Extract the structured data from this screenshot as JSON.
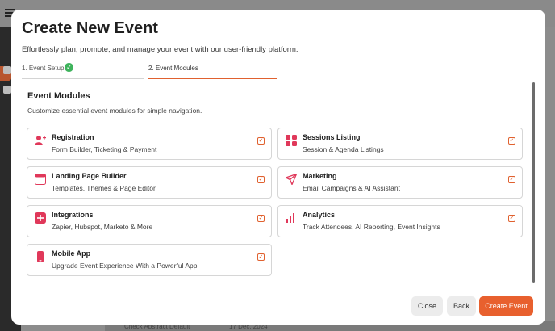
{
  "modal": {
    "title": "Create New Event",
    "subtitle": "Effortlessly plan, promote, and manage your event with our user-friendly platform."
  },
  "steps": [
    {
      "label": "1. Event Setup",
      "status": "completed"
    },
    {
      "label": "2. Event Modules",
      "status": "active"
    }
  ],
  "section": {
    "title": "Event Modules",
    "description": "Customize essential event modules for simple navigation."
  },
  "modules": [
    {
      "title": "Registration",
      "description": "Form Builder, Ticketing & Payment",
      "checked": true,
      "icon": "registration-icon"
    },
    {
      "title": "Sessions Listing",
      "description": "Session & Agenda Listings",
      "checked": true,
      "icon": "sessions-grid-icon"
    },
    {
      "title": "Landing Page Builder",
      "description": "Templates, Themes & Page Editor",
      "checked": true,
      "icon": "browser-window-icon"
    },
    {
      "title": "Marketing",
      "description": "Email Campaigns & AI Assistant",
      "checked": true,
      "icon": "paper-plane-icon"
    },
    {
      "title": "Integrations",
      "description": "Zapier, Hubspot, Marketo & More",
      "checked": true,
      "icon": "integrations-plus-icon"
    },
    {
      "title": "Analytics",
      "description": "Track Attendees, AI Reporting, Event Insights",
      "checked": true,
      "icon": "bar-chart-icon"
    },
    {
      "title": "Mobile App",
      "description": "Upgrade Event Experience With a Powerful App",
      "checked": true,
      "icon": "mobile-phone-icon"
    }
  ],
  "buttons": {
    "close": "Close",
    "back": "Back",
    "create": "Create Event"
  },
  "background": {
    "row_text": "Check Abstract Default",
    "row_date": "17 Dec, 2024"
  },
  "colors": {
    "accent": "#e8602e",
    "success": "#3eb35c",
    "icon_pink": "#e0385a"
  }
}
